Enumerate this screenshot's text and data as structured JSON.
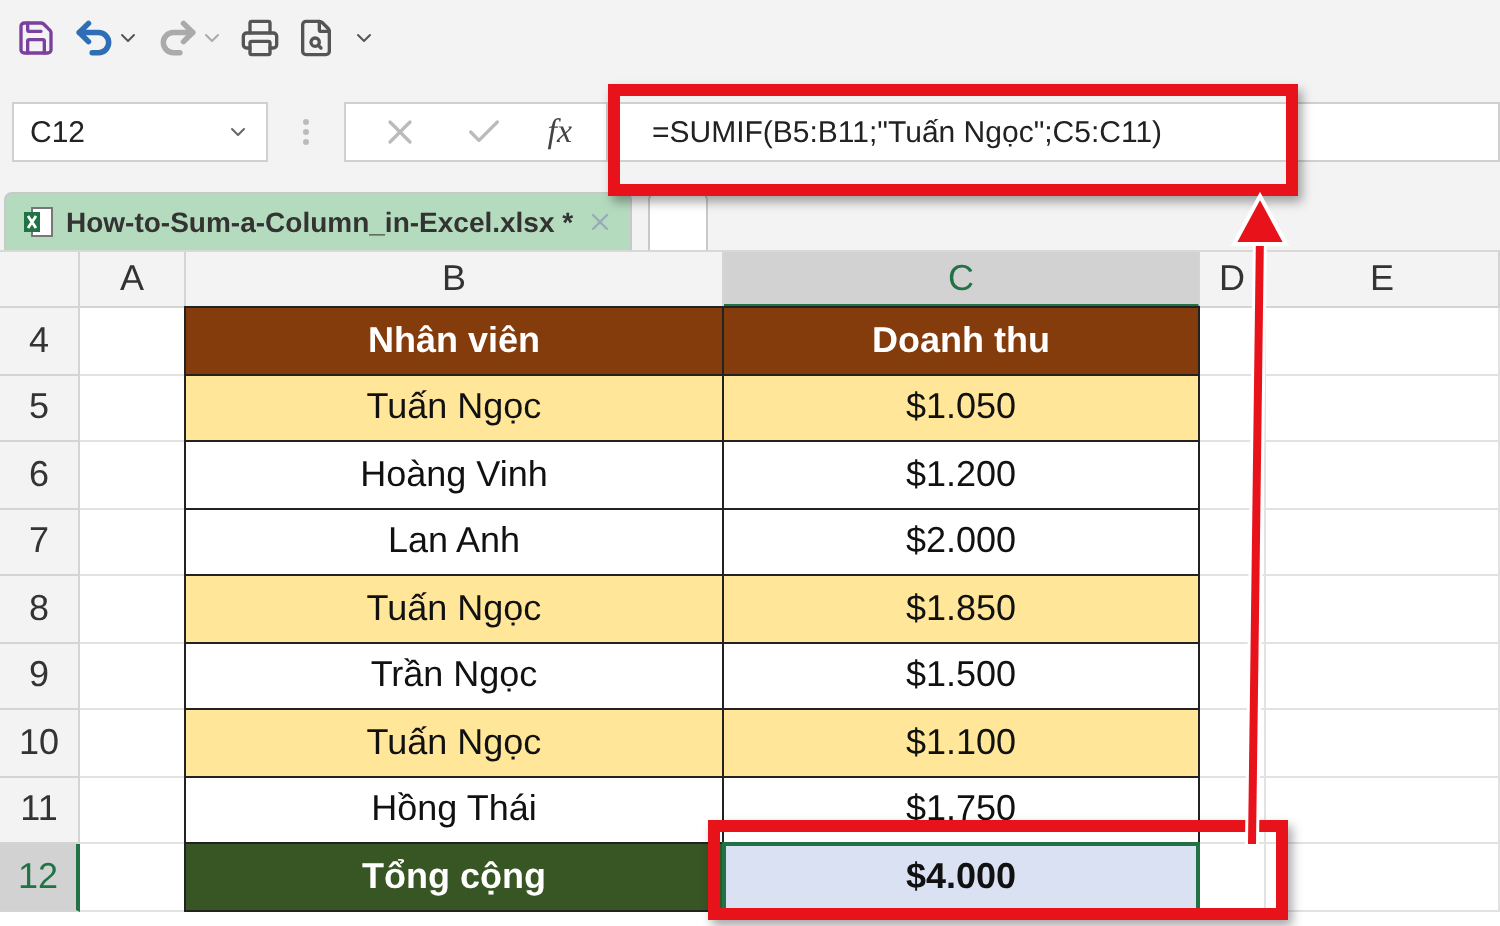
{
  "formula_bar": {
    "name_box": "C12",
    "function_label": "fx",
    "formula": "=SUMIF(B5:B11;\"Tuấn Ngọc\";C5:C11)"
  },
  "workbook_tabs": [
    {
      "label": "How-to-Sum-a-Column_in-Excel.xlsx *",
      "selected": true
    },
    {
      "selected": false
    }
  ],
  "columns": [
    {
      "label": "A",
      "selected": false
    },
    {
      "label": "B",
      "selected": false
    },
    {
      "label": "C",
      "selected": true
    },
    {
      "label": "D",
      "selected": false
    },
    {
      "label": "E",
      "selected": false
    }
  ],
  "rows": [
    {
      "row": "4",
      "kind": "header",
      "name": "Nhân viên",
      "amount": "Doanh thu",
      "selected": false
    },
    {
      "row": "5",
      "kind": "data",
      "name": "Tuấn Ngọc",
      "amount": "$1.050",
      "highlighted": true,
      "selected": false
    },
    {
      "row": "6",
      "kind": "data",
      "name": "Hoàng Vinh",
      "amount": "$1.200",
      "highlighted": false,
      "selected": false
    },
    {
      "row": "7",
      "kind": "data",
      "name": "Lan Anh",
      "amount": "$2.000",
      "highlighted": false,
      "selected": false
    },
    {
      "row": "8",
      "kind": "data",
      "name": "Tuấn Ngọc",
      "amount": "$1.850",
      "highlighted": true,
      "selected": false
    },
    {
      "row": "9",
      "kind": "data",
      "name": "Trần Ngọc",
      "amount": "$1.500",
      "highlighted": false,
      "selected": false
    },
    {
      "row": "10",
      "kind": "data",
      "name": "Tuấn Ngọc",
      "amount": "$1.100",
      "highlighted": true,
      "selected": false
    },
    {
      "row": "11",
      "kind": "data",
      "name": "Hồng Thái",
      "amount": "$1.750",
      "highlighted": false,
      "selected": false
    },
    {
      "row": "12",
      "kind": "total",
      "name": "Tổng cộng",
      "amount": "$4.000",
      "selected": true
    }
  ]
}
